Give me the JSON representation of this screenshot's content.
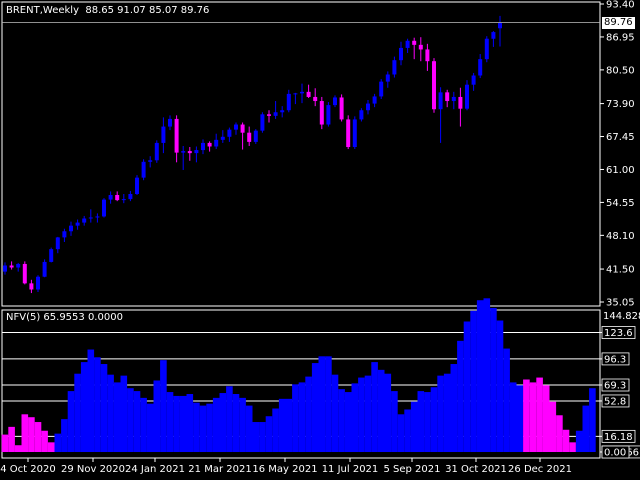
{
  "price_panel": {
    "symbol": "BRENT,Weekly",
    "ohlc": "88.65 91.07 85.07 89.76",
    "current_price": "89.76",
    "price_ticks": [
      "93.40",
      "86.95",
      "80.50",
      "73.90",
      "67.45",
      "61.00",
      "54.55",
      "48.10",
      "41.50",
      "35.05"
    ],
    "y_range": [
      35.05,
      93.4
    ],
    "up_color": "#0000FF",
    "down_color": "#FF00FF"
  },
  "indicator_panel": {
    "title": "NFV(5) 65.9553 0.0000",
    "levels": [
      "144.8282",
      "123.6",
      "96.3",
      "69.3",
      "52.8",
      "16.18",
      "0.0566",
      "0.00"
    ],
    "level_values": [
      123.6,
      96.3,
      69.3,
      52.8,
      16.18
    ],
    "y_range": [
      0,
      144.8282
    ],
    "positive_color": "#0000FF",
    "negative_color": "#FF00FF"
  },
  "date_labels": [
    "4 Oct 2020",
    "29 Nov 2020",
    "24 Jan 2021",
    "21 Mar 2021",
    "16 May 2021",
    "11 Jul 2021",
    "5 Sep 2021",
    "31 Oct 2021",
    "26 Dec 2021"
  ],
  "chart_data": [
    {
      "type": "candlestick",
      "title": "BRENT,Weekly",
      "ylim": [
        35.05,
        93.4
      ],
      "up_color": "#0000FF",
      "down_color": "#FF00FF",
      "candles": [
        [
          41.0,
          42.8,
          40.4,
          42.2
        ],
        [
          42.2,
          43.0,
          41.4,
          41.8
        ],
        [
          41.8,
          42.7,
          41.0,
          42.5
        ],
        [
          42.5,
          43.0,
          38.5,
          38.7
        ],
        [
          38.7,
          39.4,
          36.8,
          37.5
        ],
        [
          37.5,
          40.3,
          37.0,
          40.0
        ],
        [
          40.0,
          43.4,
          39.9,
          42.9
        ],
        [
          42.9,
          45.7,
          42.8,
          45.4
        ],
        [
          45.4,
          47.8,
          44.6,
          47.7
        ],
        [
          47.7,
          49.4,
          46.8,
          48.9
        ],
        [
          48.9,
          50.8,
          48.0,
          50.0
        ],
        [
          50.0,
          51.2,
          49.2,
          50.6
        ],
        [
          50.6,
          51.9,
          50.0,
          51.4
        ],
        [
          51.4,
          53.2,
          50.6,
          51.6
        ],
        [
          51.6,
          52.4,
          50.6,
          51.8
        ],
        [
          51.8,
          55.4,
          51.6,
          55.1
        ],
        [
          55.1,
          56.7,
          54.3,
          56.0
        ],
        [
          56.0,
          56.7,
          54.8,
          55.0
        ],
        [
          55.0,
          56.2,
          54.4,
          55.2
        ],
        [
          55.2,
          56.8,
          54.8,
          56.2
        ],
        [
          56.2,
          59.9,
          56.0,
          59.4
        ],
        [
          59.4,
          63.0,
          58.9,
          62.5
        ],
        [
          62.5,
          63.6,
          61.4,
          62.8
        ],
        [
          62.8,
          66.7,
          62.3,
          66.2
        ],
        [
          66.2,
          71.2,
          64.2,
          69.4
        ],
        [
          69.4,
          71.6,
          68.7,
          70.9
        ],
        [
          70.9,
          71.6,
          62.4,
          64.3
        ],
        [
          64.3,
          65.6,
          60.9,
          64.6
        ],
        [
          64.6,
          65.4,
          62.7,
          64.2
        ],
        [
          64.2,
          65.5,
          62.4,
          64.8
        ],
        [
          64.8,
          66.9,
          64.0,
          66.2
        ],
        [
          66.2,
          66.5,
          64.5,
          65.5
        ],
        [
          65.5,
          68.0,
          65.0,
          66.8
        ],
        [
          66.8,
          68.7,
          66.2,
          67.4
        ],
        [
          67.4,
          69.2,
          66.4,
          68.8
        ],
        [
          68.8,
          70.2,
          67.8,
          69.8
        ],
        [
          69.8,
          70.2,
          64.9,
          68.2
        ],
        [
          68.2,
          69.4,
          65.6,
          66.4
        ],
        [
          66.4,
          68.9,
          66.0,
          68.6
        ],
        [
          68.6,
          72.2,
          68.2,
          71.8
        ],
        [
          71.8,
          72.6,
          70.2,
          71.5
        ],
        [
          71.5,
          74.4,
          70.9,
          72.2
        ],
        [
          72.2,
          73.4,
          71.2,
          72.6
        ],
        [
          72.6,
          76.6,
          72.2,
          75.8
        ],
        [
          75.8,
          76.0,
          73.8,
          75.9
        ],
        [
          75.9,
          77.8,
          74.0,
          76.2
        ],
        [
          76.2,
          77.6,
          75.0,
          75.2
        ],
        [
          75.2,
          76.9,
          73.4,
          74.4
        ],
        [
          74.4,
          75.2,
          68.9,
          69.8
        ],
        [
          69.8,
          74.2,
          69.4,
          73.6
        ],
        [
          73.6,
          75.5,
          73.2,
          75.1
        ],
        [
          75.1,
          75.7,
          70.4,
          70.8
        ],
        [
          70.8,
          71.6,
          65.0,
          65.4
        ],
        [
          65.4,
          71.4,
          65.0,
          70.8
        ],
        [
          70.8,
          73.0,
          70.4,
          72.6
        ],
        [
          72.6,
          74.6,
          71.8,
          73.9
        ],
        [
          73.9,
          75.8,
          73.2,
          75.3
        ],
        [
          75.3,
          78.7,
          74.8,
          78.2
        ],
        [
          78.2,
          80.2,
          77.0,
          79.6
        ],
        [
          79.6,
          83.1,
          79.0,
          82.4
        ],
        [
          82.4,
          86.0,
          81.4,
          84.8
        ],
        [
          84.8,
          86.6,
          83.8,
          86.2
        ],
        [
          86.2,
          86.8,
          82.6,
          85.4
        ],
        [
          85.4,
          86.9,
          82.2,
          84.5
        ],
        [
          84.5,
          85.6,
          80.3,
          82.2
        ],
        [
          82.2,
          82.8,
          72.1,
          72.8
        ],
        [
          72.8,
          77.1,
          66.2,
          76.1
        ],
        [
          76.1,
          76.6,
          73.2,
          74.4
        ],
        [
          74.4,
          76.2,
          72.8,
          75.2
        ],
        [
          75.2,
          77.0,
          69.4,
          72.9
        ],
        [
          72.9,
          78.5,
          72.6,
          77.6
        ],
        [
          77.6,
          79.9,
          76.4,
          79.4
        ],
        [
          79.4,
          83.6,
          78.9,
          82.6
        ],
        [
          82.6,
          87.1,
          82.0,
          86.6
        ],
        [
          86.6,
          88.1,
          85.0,
          87.9
        ],
        [
          88.65,
          91.07,
          85.07,
          89.76
        ]
      ]
    },
    {
      "type": "bar",
      "title": "NFV(5) 65.9553 0.0000",
      "ylim": [
        0,
        144.8282
      ],
      "positive_color": "#0000FF",
      "negative_color": "#FF00FF",
      "values": [
        -18,
        -26,
        -7,
        -39,
        -36,
        -31,
        -22,
        -10,
        19,
        34,
        63,
        81,
        93,
        106,
        98,
        91,
        80,
        72,
        79,
        66,
        63,
        56,
        50,
        74,
        95,
        62,
        58,
        58,
        60,
        51,
        48,
        50,
        56,
        61,
        68,
        60,
        56,
        48,
        31,
        31,
        37,
        45,
        55,
        55,
        70,
        72,
        78,
        92,
        99,
        99,
        80,
        65,
        62,
        71,
        77,
        79,
        93,
        85,
        81,
        63,
        39,
        44,
        52,
        63,
        62,
        67,
        79,
        81,
        91,
        115,
        135,
        146,
        157,
        159,
        149,
        136,
        107,
        72,
        69,
        -75,
        -72,
        -77,
        -69,
        -52,
        -38,
        -23,
        -10,
        22,
        48,
        66
      ]
    }
  ]
}
